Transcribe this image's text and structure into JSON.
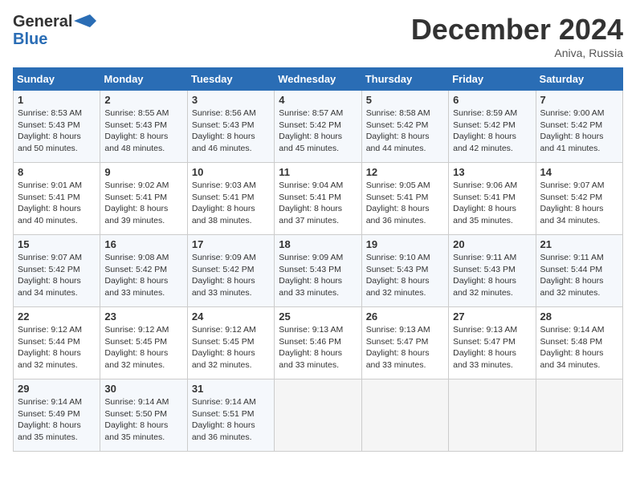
{
  "header": {
    "logo_line1": "General",
    "logo_line2": "Blue",
    "month_title": "December 2024",
    "location": "Aniva, Russia"
  },
  "weekdays": [
    "Sunday",
    "Monday",
    "Tuesday",
    "Wednesday",
    "Thursday",
    "Friday",
    "Saturday"
  ],
  "weeks": [
    [
      {
        "day": "1",
        "sunrise": "8:53 AM",
        "sunset": "5:43 PM",
        "daylight": "8 hours and 50 minutes."
      },
      {
        "day": "2",
        "sunrise": "8:55 AM",
        "sunset": "5:43 PM",
        "daylight": "8 hours and 48 minutes."
      },
      {
        "day": "3",
        "sunrise": "8:56 AM",
        "sunset": "5:43 PM",
        "daylight": "8 hours and 46 minutes."
      },
      {
        "day": "4",
        "sunrise": "8:57 AM",
        "sunset": "5:42 PM",
        "daylight": "8 hours and 45 minutes."
      },
      {
        "day": "5",
        "sunrise": "8:58 AM",
        "sunset": "5:42 PM",
        "daylight": "8 hours and 44 minutes."
      },
      {
        "day": "6",
        "sunrise": "8:59 AM",
        "sunset": "5:42 PM",
        "daylight": "8 hours and 42 minutes."
      },
      {
        "day": "7",
        "sunrise": "9:00 AM",
        "sunset": "5:42 PM",
        "daylight": "8 hours and 41 minutes."
      }
    ],
    [
      {
        "day": "8",
        "sunrise": "9:01 AM",
        "sunset": "5:41 PM",
        "daylight": "8 hours and 40 minutes."
      },
      {
        "day": "9",
        "sunrise": "9:02 AM",
        "sunset": "5:41 PM",
        "daylight": "8 hours and 39 minutes."
      },
      {
        "day": "10",
        "sunrise": "9:03 AM",
        "sunset": "5:41 PM",
        "daylight": "8 hours and 38 minutes."
      },
      {
        "day": "11",
        "sunrise": "9:04 AM",
        "sunset": "5:41 PM",
        "daylight": "8 hours and 37 minutes."
      },
      {
        "day": "12",
        "sunrise": "9:05 AM",
        "sunset": "5:41 PM",
        "daylight": "8 hours and 36 minutes."
      },
      {
        "day": "13",
        "sunrise": "9:06 AM",
        "sunset": "5:41 PM",
        "daylight": "8 hours and 35 minutes."
      },
      {
        "day": "14",
        "sunrise": "9:07 AM",
        "sunset": "5:42 PM",
        "daylight": "8 hours and 34 minutes."
      }
    ],
    [
      {
        "day": "15",
        "sunrise": "9:07 AM",
        "sunset": "5:42 PM",
        "daylight": "8 hours and 34 minutes."
      },
      {
        "day": "16",
        "sunrise": "9:08 AM",
        "sunset": "5:42 PM",
        "daylight": "8 hours and 33 minutes."
      },
      {
        "day": "17",
        "sunrise": "9:09 AM",
        "sunset": "5:42 PM",
        "daylight": "8 hours and 33 minutes."
      },
      {
        "day": "18",
        "sunrise": "9:09 AM",
        "sunset": "5:43 PM",
        "daylight": "8 hours and 33 minutes."
      },
      {
        "day": "19",
        "sunrise": "9:10 AM",
        "sunset": "5:43 PM",
        "daylight": "8 hours and 32 minutes."
      },
      {
        "day": "20",
        "sunrise": "9:11 AM",
        "sunset": "5:43 PM",
        "daylight": "8 hours and 32 minutes."
      },
      {
        "day": "21",
        "sunrise": "9:11 AM",
        "sunset": "5:44 PM",
        "daylight": "8 hours and 32 minutes."
      }
    ],
    [
      {
        "day": "22",
        "sunrise": "9:12 AM",
        "sunset": "5:44 PM",
        "daylight": "8 hours and 32 minutes."
      },
      {
        "day": "23",
        "sunrise": "9:12 AM",
        "sunset": "5:45 PM",
        "daylight": "8 hours and 32 minutes."
      },
      {
        "day": "24",
        "sunrise": "9:12 AM",
        "sunset": "5:45 PM",
        "daylight": "8 hours and 32 minutes."
      },
      {
        "day": "25",
        "sunrise": "9:13 AM",
        "sunset": "5:46 PM",
        "daylight": "8 hours and 33 minutes."
      },
      {
        "day": "26",
        "sunrise": "9:13 AM",
        "sunset": "5:47 PM",
        "daylight": "8 hours and 33 minutes."
      },
      {
        "day": "27",
        "sunrise": "9:13 AM",
        "sunset": "5:47 PM",
        "daylight": "8 hours and 33 minutes."
      },
      {
        "day": "28",
        "sunrise": "9:14 AM",
        "sunset": "5:48 PM",
        "daylight": "8 hours and 34 minutes."
      }
    ],
    [
      {
        "day": "29",
        "sunrise": "9:14 AM",
        "sunset": "5:49 PM",
        "daylight": "8 hours and 35 minutes."
      },
      {
        "day": "30",
        "sunrise": "9:14 AM",
        "sunset": "5:50 PM",
        "daylight": "8 hours and 35 minutes."
      },
      {
        "day": "31",
        "sunrise": "9:14 AM",
        "sunset": "5:51 PM",
        "daylight": "8 hours and 36 minutes."
      },
      null,
      null,
      null,
      null
    ]
  ]
}
